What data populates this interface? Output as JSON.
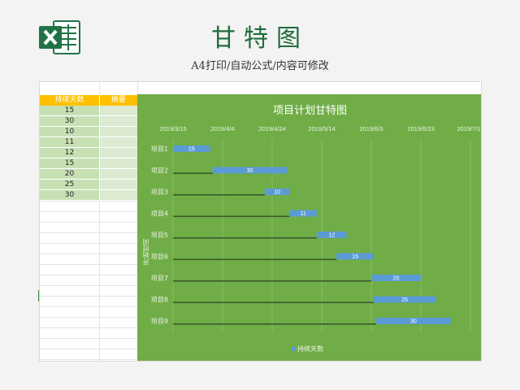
{
  "header": {
    "title": "甘特图",
    "subtitle": "A4打印/自动公式/内容可修改"
  },
  "table": {
    "col_duration": "持续天数",
    "col_note": "摘要",
    "rows": [
      "15",
      "30",
      "10",
      "11",
      "12",
      "15",
      "20",
      "25",
      "30"
    ]
  },
  "chart_data": {
    "type": "bar",
    "orientation": "horizontal",
    "stacked": true,
    "title": "项目计划甘特图",
    "categories": [
      "项目1",
      "项目2",
      "项目3",
      "项目4",
      "项目5",
      "项目6",
      "项目7",
      "项目8",
      "项目9"
    ],
    "x_ticks": [
      "2019/3/15",
      "2019/4/4",
      "2019/4/24",
      "2019/5/14",
      "2019/6/3",
      "2019/6/23",
      "2019/7/13"
    ],
    "xlim": [
      "2019/3/15",
      "2019/7/13"
    ],
    "start_dates": [
      "2019/3/15",
      "2019/3/31",
      "2019/4/21",
      "2019/5/1",
      "2019/5/12",
      "2019/5/20",
      "2019/6/3",
      "2019/6/4",
      "2019/6/5"
    ],
    "series": [
      {
        "name": "持续天数",
        "values": [
          15,
          30,
          10,
          11,
          12,
          15,
          20,
          25,
          30
        ]
      }
    ],
    "ylabel": "开始时间",
    "legend_position": "bottom",
    "colors": {
      "background": "#70ad47",
      "bar": "#5b9bd5",
      "start_line": "#3a5a2a"
    }
  },
  "colors": {
    "brand": "#1f6d3c",
    "header_fill": "#ffc000",
    "row_fill": "#c6e0b4"
  }
}
